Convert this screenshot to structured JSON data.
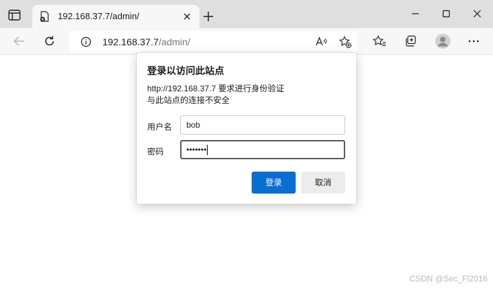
{
  "browser": {
    "tab": {
      "title": "192.168.37.7/admin/"
    },
    "address": {
      "host": "192.168.37.7",
      "path": "/admin/"
    }
  },
  "dialog": {
    "title": "登录以访问此站点",
    "message_line1": "http://192.168.37.7 要求进行身份验证",
    "message_line2": "与此站点的连接不安全",
    "username_label": "用户名",
    "username_value": "bob",
    "password_label": "密码",
    "password_value": "•••••••",
    "login_button": "登录",
    "cancel_button": "取消"
  },
  "watermark": "CSDN @Sec_Fl2016"
}
